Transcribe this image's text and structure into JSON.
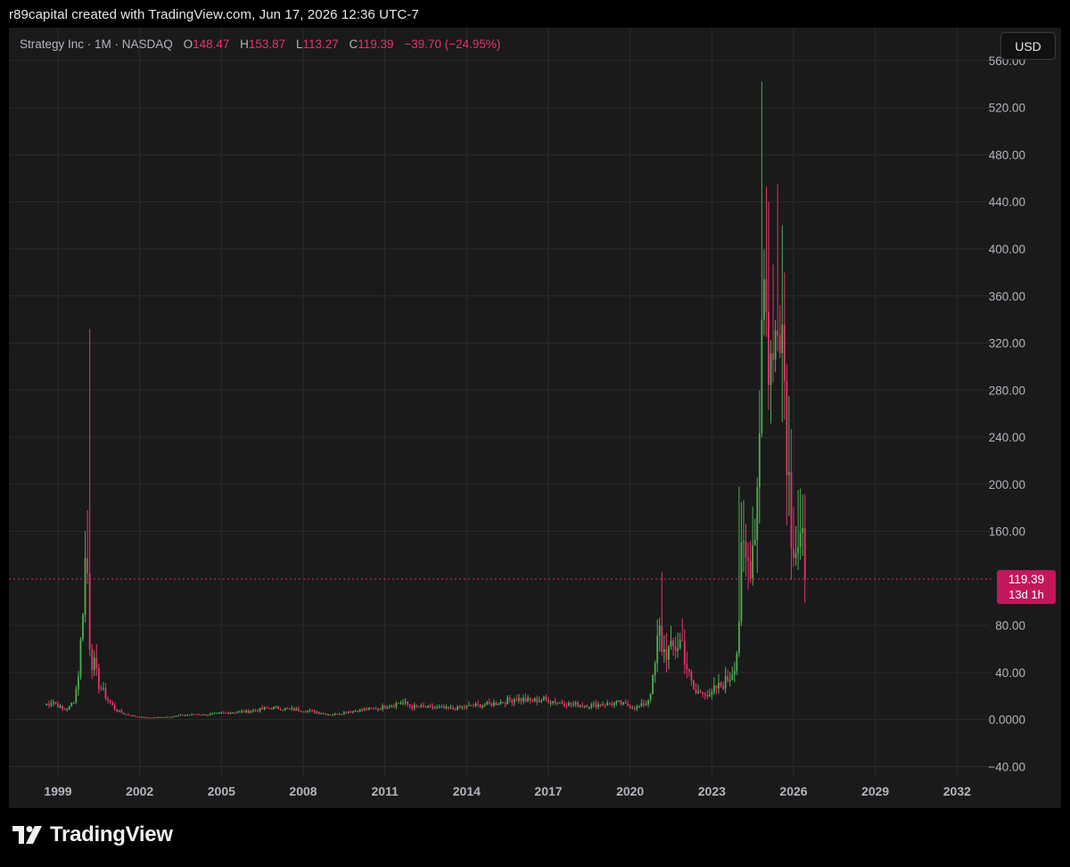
{
  "header": {
    "credit": "r89capital created with TradingView.com, Jun 17, 2026 12:36 UTC-7"
  },
  "legend": {
    "symbol": "Strategy Inc · 1M · NASDAQ",
    "o_label": "O",
    "o_value": "148.47",
    "h_label": "H",
    "h_value": "153.87",
    "l_label": "L",
    "l_value": "113.27",
    "c_label": "C",
    "c_value": "119.39",
    "change": "−39.70 (−24.95%)"
  },
  "currency_button": "USD",
  "price_tag": {
    "price": "119.39",
    "countdown": "13d 1h"
  },
  "brand": {
    "name": "TradingView"
  },
  "colors": {
    "up": "#4caf50",
    "down": "#e5336b",
    "background": "#1a1a1a",
    "grid": "#2b2b2b",
    "axis_text": "#b2b5be"
  },
  "chart_data": {
    "type": "candlestick",
    "interval": "1M",
    "ylim": [
      -48,
      588
    ],
    "xlim": [
      1997.2,
      2033.2
    ],
    "y_ticks": [
      {
        "value": 560,
        "label": "560.00"
      },
      {
        "value": 520,
        "label": "520.00"
      },
      {
        "value": 480,
        "label": "480.00"
      },
      {
        "value": 440,
        "label": "440.00"
      },
      {
        "value": 400,
        "label": "400.00"
      },
      {
        "value": 360,
        "label": "360.00"
      },
      {
        "value": 320,
        "label": "320.00"
      },
      {
        "value": 280,
        "label": "280.00"
      },
      {
        "value": 240,
        "label": "240.00"
      },
      {
        "value": 200,
        "label": "200.00"
      },
      {
        "value": 160,
        "label": "160.00"
      },
      {
        "value": 80,
        "label": "80.00"
      },
      {
        "value": 40,
        "label": "40.00"
      },
      {
        "value": 0,
        "label": "0.0000"
      },
      {
        "value": -40,
        "label": "−40.00"
      }
    ],
    "x_ticks": [
      {
        "value": 1999,
        "label": "1999"
      },
      {
        "value": 2002,
        "label": "2002"
      },
      {
        "value": 2005,
        "label": "2005"
      },
      {
        "value": 2008,
        "label": "2008"
      },
      {
        "value": 2011,
        "label": "2011"
      },
      {
        "value": 2014,
        "label": "2014"
      },
      {
        "value": 2017,
        "label": "2017"
      },
      {
        "value": 2020,
        "label": "2020"
      },
      {
        "value": 2023,
        "label": "2023"
      },
      {
        "value": 2026,
        "label": "2026"
      },
      {
        "value": 2029,
        "label": "2029"
      },
      {
        "value": 2032,
        "label": "2032"
      }
    ],
    "last_close": 119.39,
    "anchors": [
      [
        1998.5,
        12
      ],
      [
        1998.8,
        16
      ],
      [
        1999.0,
        12
      ],
      [
        1999.2,
        8
      ],
      [
        1999.4,
        10
      ],
      [
        1999.6,
        18
      ],
      [
        1999.75,
        40
      ],
      [
        1999.9,
        95
      ],
      [
        2000.05,
        160
      ],
      [
        2000.2,
        52
      ],
      [
        2000.35,
        45
      ],
      [
        2000.5,
        30
      ],
      [
        2000.7,
        22
      ],
      [
        2000.9,
        15
      ],
      [
        2001.1,
        9
      ],
      [
        2001.4,
        5
      ],
      [
        2001.8,
        3
      ],
      [
        2002.2,
        1.5
      ],
      [
        2002.8,
        2
      ],
      [
        2003.5,
        3.5
      ],
      [
        2004.0,
        4.5
      ],
      [
        2004.5,
        4
      ],
      [
        2005.0,
        5.5
      ],
      [
        2006.0,
        7
      ],
      [
        2006.8,
        10
      ],
      [
        2007.4,
        9
      ],
      [
        2008.0,
        8
      ],
      [
        2008.6,
        6
      ],
      [
        2009.0,
        4
      ],
      [
        2009.5,
        6
      ],
      [
        2010.0,
        8
      ],
      [
        2010.6,
        9
      ],
      [
        2011.2,
        12
      ],
      [
        2011.6,
        15
      ],
      [
        2012.0,
        11
      ],
      [
        2012.8,
        10
      ],
      [
        2013.5,
        9
      ],
      [
        2014.0,
        11
      ],
      [
        2014.8,
        13
      ],
      [
        2015.3,
        15
      ],
      [
        2015.8,
        18
      ],
      [
        2016.3,
        16
      ],
      [
        2016.9,
        17
      ],
      [
        2017.3,
        15
      ],
      [
        2017.8,
        13
      ],
      [
        2018.5,
        12
      ],
      [
        2019.0,
        13
      ],
      [
        2019.6,
        14
      ],
      [
        2020.2,
        10
      ],
      [
        2020.6,
        14
      ],
      [
        2020.85,
        35
      ],
      [
        2021.05,
        80
      ],
      [
        2021.2,
        58
      ],
      [
        2021.5,
        58
      ],
      [
        2021.9,
        68
      ],
      [
        2022.15,
        38
      ],
      [
        2022.4,
        22
      ],
      [
        2022.7,
        26
      ],
      [
        2022.9,
        18
      ],
      [
        2023.1,
        26
      ],
      [
        2023.4,
        30
      ],
      [
        2023.7,
        38
      ],
      [
        2023.9,
        55
      ],
      [
        2024.1,
        140
      ],
      [
        2024.3,
        130
      ],
      [
        2024.5,
        150
      ],
      [
        2024.7,
        210
      ],
      [
        2024.85,
        400
      ],
      [
        2025.05,
        320
      ],
      [
        2025.25,
        290
      ],
      [
        2025.45,
        400
      ],
      [
        2025.6,
        330
      ],
      [
        2025.75,
        250
      ],
      [
        2025.9,
        170
      ],
      [
        2026.1,
        150
      ],
      [
        2026.3,
        150
      ],
      [
        2026.42,
        119.39
      ]
    ],
    "spikes": [
      [
        2000.2,
        332
      ],
      [
        2000.1,
        178
      ],
      [
        2000.0,
        160
      ],
      [
        2021.15,
        125
      ],
      [
        2021.9,
        86
      ],
      [
        2024.0,
        198
      ],
      [
        2024.85,
        542
      ],
      [
        2025.05,
        440
      ],
      [
        2025.45,
        455
      ],
      [
        2025.55,
        420
      ],
      [
        2025.7,
        365
      ],
      [
        2025.85,
        275
      ],
      [
        2026.2,
        195
      ],
      [
        2026.35,
        160
      ]
    ]
  }
}
